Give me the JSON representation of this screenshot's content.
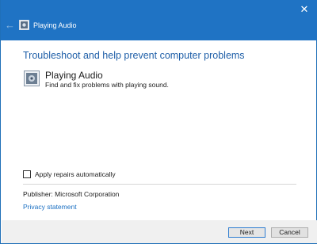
{
  "window": {
    "title": "Playing Audio",
    "close_glyph": "✕",
    "back_glyph": "←",
    "title_icon": "troubleshooter-icon"
  },
  "main": {
    "heading": "Troubleshoot and help prevent computer problems",
    "item": {
      "title": "Playing Audio",
      "description": "Find and fix problems with playing sound.",
      "icon": "audio-troubleshooter-icon"
    },
    "apply_repairs_label": "Apply repairs automatically",
    "apply_repairs_checked": false,
    "publisher": "Publisher:  Microsoft Corporation",
    "privacy_link": "Privacy statement"
  },
  "footer": {
    "next_label": "Next",
    "cancel_label": "Cancel"
  },
  "colors": {
    "titlebar": "#1f73c4",
    "heading": "#1f5fa8",
    "link": "#1a6fc2"
  }
}
